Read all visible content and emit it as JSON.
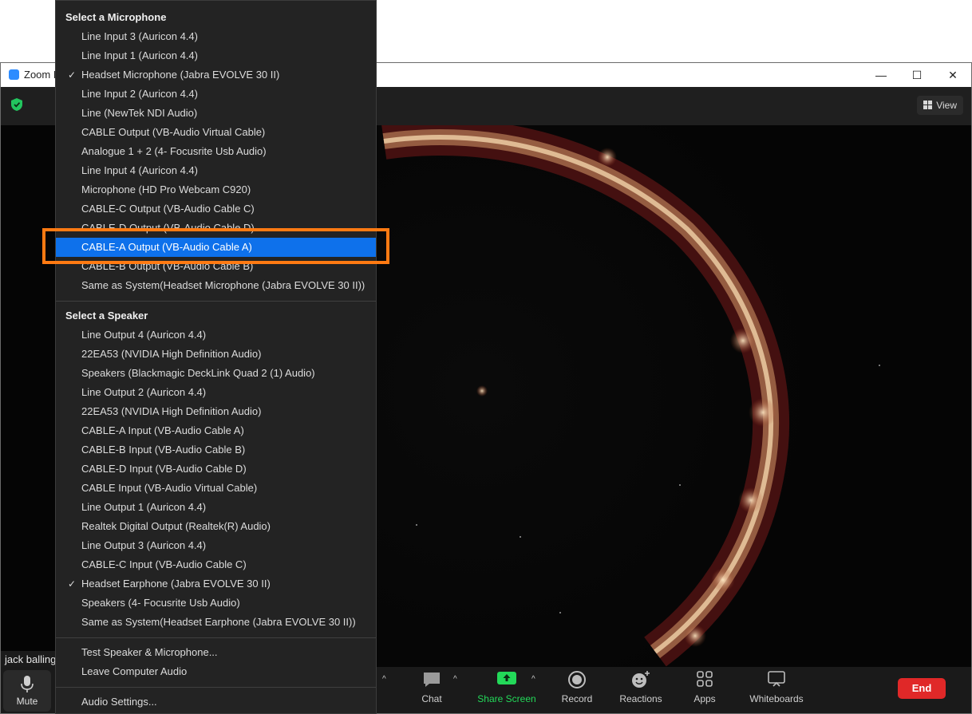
{
  "window": {
    "title": "Zoom M",
    "controls": {
      "minimize": "—",
      "maximize": "☐",
      "close": "✕"
    }
  },
  "topbar": {
    "view_label": "View"
  },
  "participant": {
    "name": "jack balling"
  },
  "toolbar": {
    "mute_label": "Mute",
    "chat_label": "Chat",
    "share_label": "Share Screen",
    "record_label": "Record",
    "reactions_label": "Reactions",
    "apps_label": "Apps",
    "whiteboards_label": "Whiteboards",
    "end_label": "End",
    "caret": "^"
  },
  "menu": {
    "microphone_header": "Select a Microphone",
    "microphones": [
      {
        "label": "Line Input 3 (Auricon 4.4)"
      },
      {
        "label": "Line Input 1 (Auricon 4.4)"
      },
      {
        "label": "Headset Microphone (Jabra EVOLVE 30 II)",
        "checked": true
      },
      {
        "label": "Line Input 2 (Auricon 4.4)"
      },
      {
        "label": "Line (NewTek NDI Audio)"
      },
      {
        "label": "CABLE Output (VB-Audio Virtual Cable)"
      },
      {
        "label": "Analogue 1 + 2 (4- Focusrite Usb Audio)"
      },
      {
        "label": "Line Input 4 (Auricon 4.4)"
      },
      {
        "label": "Microphone (HD Pro Webcam C920)"
      },
      {
        "label": "CABLE-C Output (VB-Audio Cable C)"
      },
      {
        "label": "CABLE-D Output (VB-Audio Cable D)"
      },
      {
        "label": "CABLE-A Output (VB-Audio Cable A)",
        "selected": true
      },
      {
        "label": "CABLE-B Output (VB-Audio Cable B)"
      },
      {
        "label": "Same as System(Headset Microphone (Jabra EVOLVE 30 II))"
      }
    ],
    "speaker_header": "Select a Speaker",
    "speakers": [
      {
        "label": "Line Output 4 (Auricon 4.4)"
      },
      {
        "label": "22EA53 (NVIDIA High Definition Audio)"
      },
      {
        "label": "Speakers (Blackmagic DeckLink Quad 2 (1) Audio)"
      },
      {
        "label": "Line Output 2 (Auricon 4.4)"
      },
      {
        "label": "22EA53 (NVIDIA High Definition Audio)"
      },
      {
        "label": "CABLE-A Input (VB-Audio Cable A)"
      },
      {
        "label": "CABLE-B Input (VB-Audio Cable B)"
      },
      {
        "label": "CABLE-D Input (VB-Audio Cable D)"
      },
      {
        "label": "CABLE Input (VB-Audio Virtual Cable)"
      },
      {
        "label": "Line Output 1 (Auricon 4.4)"
      },
      {
        "label": "Realtek Digital Output (Realtek(R) Audio)"
      },
      {
        "label": "Line Output 3 (Auricon 4.4)"
      },
      {
        "label": "CABLE-C Input (VB-Audio Cable C)"
      },
      {
        "label": "Headset Earphone (Jabra EVOLVE 30 II)",
        "checked": true
      },
      {
        "label": "Speakers (4- Focusrite Usb Audio)"
      },
      {
        "label": "Same as System(Headset Earphone (Jabra EVOLVE 30 II))"
      }
    ],
    "test_label": "Test Speaker & Microphone...",
    "leave_label": "Leave Computer Audio",
    "settings_label": "Audio Settings...",
    "check_glyph": "✓"
  },
  "colors": {
    "selection": "#0e71eb",
    "highlight_box": "#ff7a12",
    "end_button": "#e02828",
    "share_green": "#23d959"
  }
}
